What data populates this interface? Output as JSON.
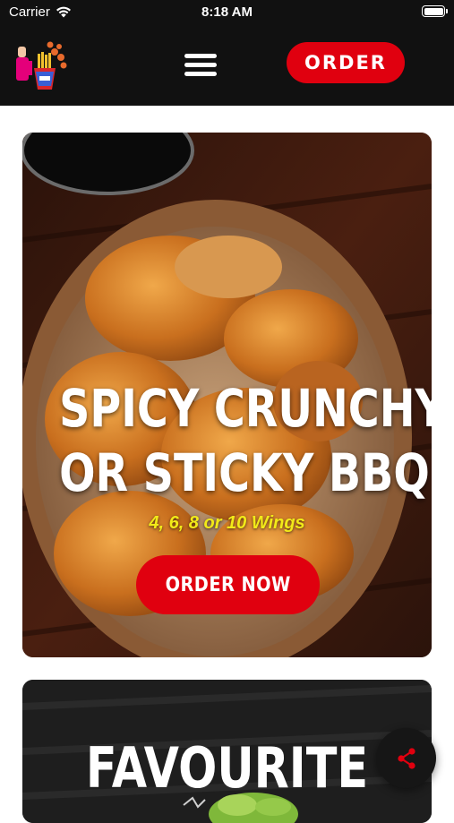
{
  "status_bar": {
    "carrier": "Carrier",
    "time": "8:18 AM"
  },
  "header": {
    "order_label": "ORDER",
    "logo_icon": "restaurant-logo-icon",
    "menu_icon": "hamburger-menu-icon"
  },
  "hero": {
    "title_line1": "SPICY CRUNCHY",
    "title_line2": "OR STICKY BBQ",
    "subtitle": "4, 6, 8 or 10 Wings",
    "cta_label": "ORDER NOW",
    "image_icon": "fried-chicken-image"
  },
  "favourite": {
    "title": "FAVOURITE"
  },
  "share": {
    "icon": "share-icon"
  },
  "colors": {
    "brand_red": "#e0000f",
    "header_bg": "#111111",
    "subtitle_yellow": "#f2ea18"
  }
}
